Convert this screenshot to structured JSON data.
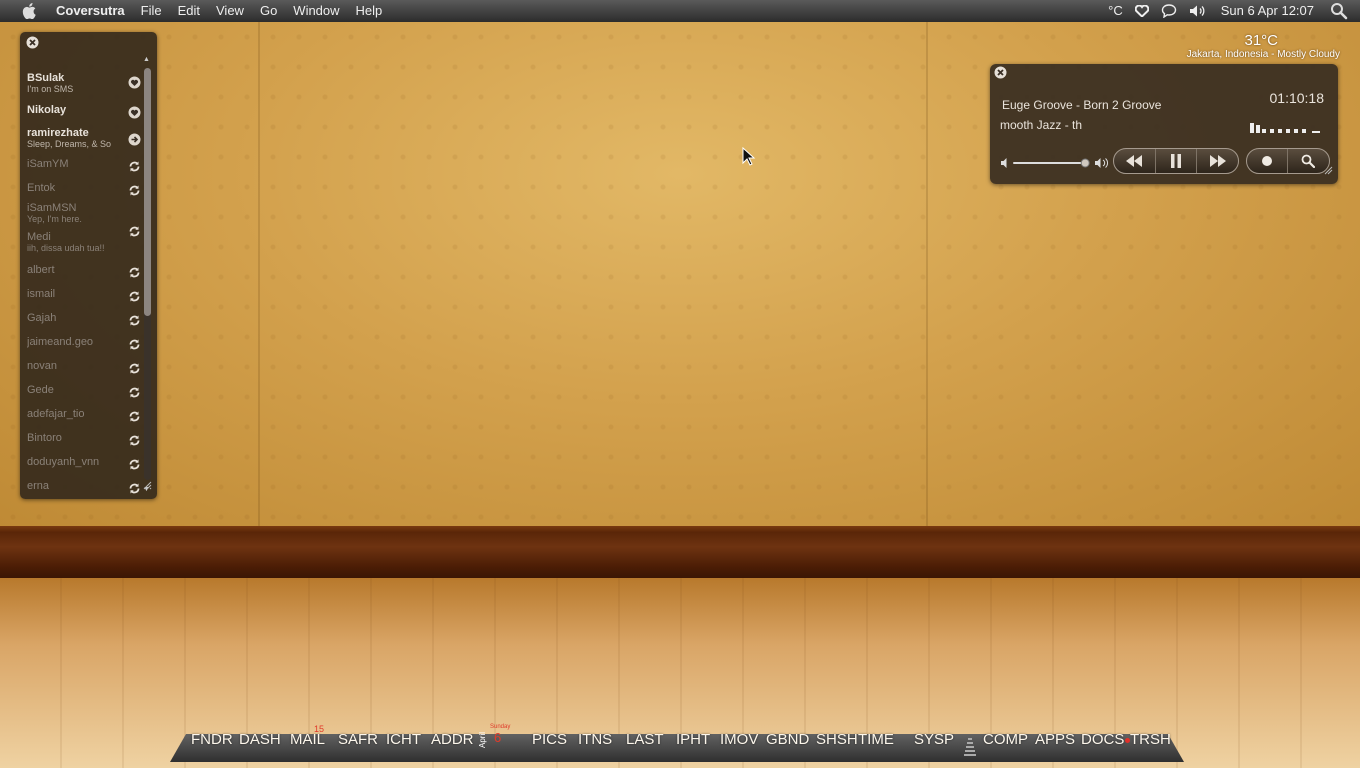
{
  "menubar": {
    "app_name": "Coversutra",
    "items": [
      "File",
      "Edit",
      "View",
      "Go",
      "Window",
      "Help"
    ],
    "temp_unit": "°C",
    "clock": "Sun 6 Apr 12:07"
  },
  "weather": {
    "temperature": "31°C",
    "location": "Jakarta, Indonesia - Mostly Cloudy"
  },
  "buddy_list": {
    "contacts": [
      {
        "name": "BSulak",
        "status": "I'm on SMS",
        "online": true,
        "icon": "heart-icon"
      },
      {
        "name": "Nikolay",
        "status": "",
        "online": true,
        "icon": "heart-icon"
      },
      {
        "name": "ramirezhate",
        "status": "Sleep, Dreams, & So",
        "online": true,
        "icon": "arrow-right-icon"
      },
      {
        "name": "iSamYM",
        "status": "",
        "online": false,
        "icon": "refresh-icon"
      },
      {
        "name": "Entok",
        "status": "",
        "online": false,
        "icon": "refresh-icon"
      },
      {
        "name": "iSamMSN",
        "status": "Yep, I'm here.",
        "online": false,
        "icon": ""
      },
      {
        "name": "Medi",
        "status": "iih, dissa udah tua!!",
        "online": false,
        "icon": "refresh-icon"
      },
      {
        "name": "albert",
        "status": "",
        "online": false,
        "icon": "refresh-icon"
      },
      {
        "name": "ismail",
        "status": "",
        "online": false,
        "icon": "refresh-icon"
      },
      {
        "name": "Gajah",
        "status": "",
        "online": false,
        "icon": "refresh-icon"
      },
      {
        "name": "jaimeand.geo",
        "status": "",
        "online": false,
        "icon": "refresh-icon"
      },
      {
        "name": "novan",
        "status": "",
        "online": false,
        "icon": "refresh-icon"
      },
      {
        "name": "Gede",
        "status": "",
        "online": false,
        "icon": "refresh-icon"
      },
      {
        "name": "adefajar_tio",
        "status": "",
        "online": false,
        "icon": "refresh-icon"
      },
      {
        "name": "Bintoro",
        "status": "",
        "online": false,
        "icon": "refresh-icon"
      },
      {
        "name": "doduyanh_vnn",
        "status": "",
        "online": false,
        "icon": "refresh-icon"
      },
      {
        "name": "erna",
        "status": "",
        "online": false,
        "icon": "refresh-icon"
      }
    ]
  },
  "player": {
    "track": "Euge Groove - Born 2 Groove",
    "album": "mooth Jazz - th",
    "time": "01:10:18",
    "volume": 0.95
  },
  "dock": {
    "items": [
      "FNDR",
      "DASH",
      "MAIL",
      "SAFR",
      "ICHT",
      "ADDR",
      "PICS",
      "ITNS",
      "LAST",
      "IPHT",
      "IMOV",
      "GBND",
      "SHSH",
      "TIME",
      "SYSP",
      "COMP",
      "APPS",
      "DOCS",
      "TRSH"
    ],
    "mail_badge": "15",
    "calendar_month": "April",
    "calendar_day_name": "Sunday",
    "calendar_day": "6"
  }
}
